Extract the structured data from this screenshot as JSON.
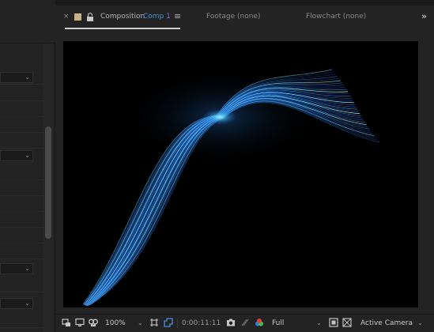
{
  "tabs": {
    "close_glyph": "×",
    "composition_label": "Composition",
    "composition_name": "Comp 1",
    "menu_glyph": "≡",
    "footage": "Footage (none)",
    "flowchart": "Flowchart (none)",
    "overflow_glyph": "»"
  },
  "left_panel": {
    "dropdown_chevron": "⌄"
  },
  "toolbar": {
    "zoom": "100%",
    "zoom_chevron": "⌄",
    "timecode": "0:00:11:11",
    "resolution": "Full",
    "resolution_chevron": "⌄",
    "camera": "Active Camera",
    "camera_chevron": "⌄"
  },
  "colors": {
    "accent_blue": "#4b8fd9",
    "label_tan": "#c9b08a",
    "fiber_bright": "#7fe6ff",
    "fiber_deep": "#1556c4"
  },
  "icons": [
    "composition-settings-icon",
    "display-icon",
    "mask-visibility-icon",
    "region-of-interest-icon",
    "transparency-grid-icon",
    "snapshot-camera-icon",
    "show-snapshot-icon",
    "channel-color-icon",
    "fast-previews-icon",
    "toggle-grid-icon",
    "lock-icon"
  ]
}
